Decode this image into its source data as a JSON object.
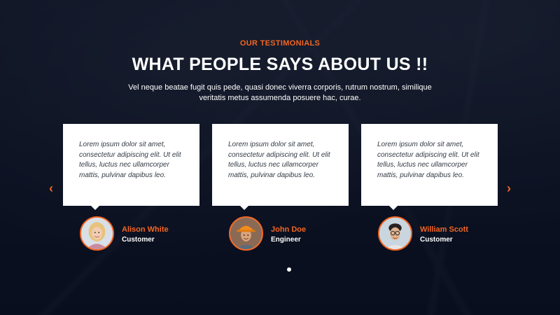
{
  "section": {
    "subtitle": "OUR TESTIMONIALS",
    "title": "WHAT PEOPLE SAYS ABOUT US !!",
    "description_line1": "Vel neque beatae fugit quis pede, quasi donec viverra corporis, rutrum nostrum, similique",
    "description_line2": "veritatis metus assumenda posuere hac, curae."
  },
  "testimonials": [
    {
      "text": "Lorem ipsum dolor sit amet, consectetur adipiscing elit. Ut elit tellus, luctus nec ullamcorper mattis, pulvinar dapibus leo.",
      "name": "Alison White",
      "role": "Customer",
      "avatar_icon": "woman-avatar-icon"
    },
    {
      "text": "Lorem ipsum dolor sit amet, consectetur adipiscing elit. Ut elit tellus, luctus nec ullamcorper mattis, pulvinar dapibus leo.",
      "name": "John Doe",
      "role": "Engineer",
      "avatar_icon": "engineer-avatar-icon"
    },
    {
      "text": "Lorem ipsum dolor sit amet, consectetur adipiscing elit. Ut elit tellus, luctus nec ullamcorper mattis, pulvinar dapibus leo.",
      "name": "William Scott",
      "role": "Customer",
      "avatar_icon": "man-glasses-avatar-icon"
    }
  ],
  "navigation": {
    "prev_icon": "chevron-left-icon",
    "next_icon": "chevron-right-icon",
    "prev_glyph": "‹",
    "next_glyph": "›",
    "active_dot": 1,
    "dot_count": 1
  },
  "colors": {
    "accent": "#f26522",
    "background": "#0d1424",
    "card": "#ffffff",
    "heading": "#ffffff"
  }
}
